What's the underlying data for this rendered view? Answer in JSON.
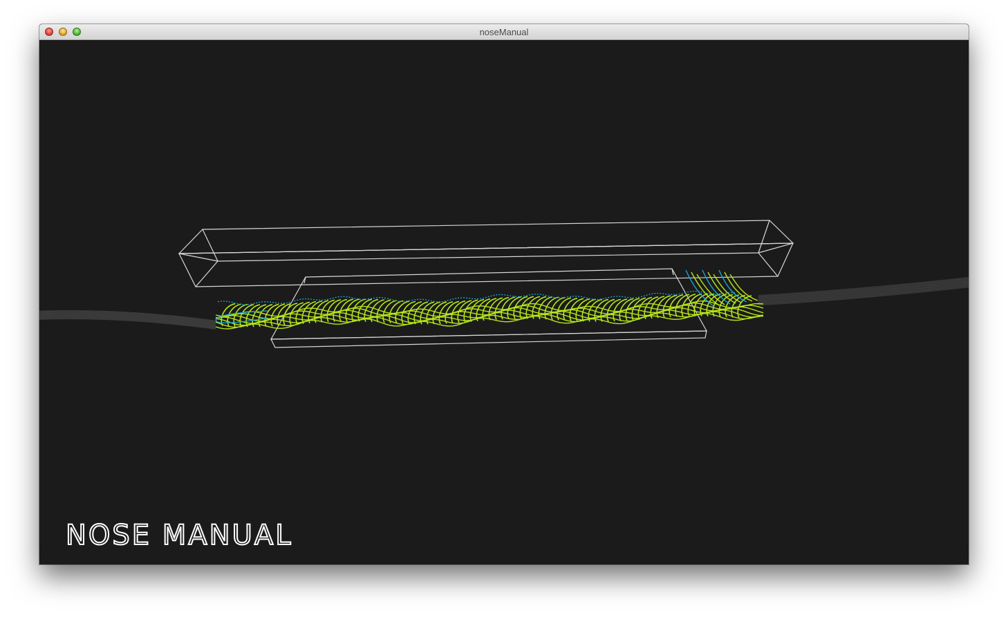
{
  "window": {
    "title": "noseManual"
  },
  "canvas": {
    "background": "#1b1b1b",
    "logo_text": "nose manual"
  },
  "colors": {
    "wireframe": "#d8d8d8",
    "stroke_primary": "#b6e61a",
    "stroke_accent": "#1aa7d6",
    "ground_lines": "#5a5a5a"
  },
  "icons": [
    "close-icon",
    "minimize-icon",
    "zoom-icon"
  ]
}
